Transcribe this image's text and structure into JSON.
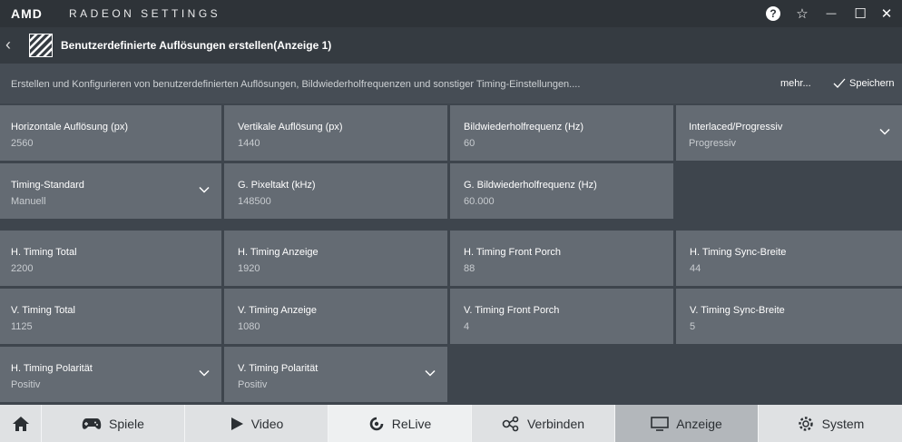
{
  "app": {
    "brand": "AMD",
    "title": "RADEON SETTINGS"
  },
  "window_controls": {
    "help": "?",
    "favorite": "☆",
    "minimize": "—",
    "maximize": "☐",
    "close": "✕"
  },
  "header": {
    "back": "‹",
    "title": "Benutzerdefinierte Auflösungen erstellen(Anzeige 1)"
  },
  "subheader": {
    "description": "Erstellen und Konfigurieren von benutzerdefinierten Auflösungen, Bildwiederholfrequenzen und sonstiger Timing-Einstellungen....",
    "more": "mehr...",
    "save": "Speichern"
  },
  "fields": {
    "h_res": {
      "label": "Horizontale Auflösung (px)",
      "value": "2560"
    },
    "v_res": {
      "label": "Vertikale Auflösung (px)",
      "value": "1440"
    },
    "refresh": {
      "label": "Bildwiederholfrequenz (Hz)",
      "value": "60"
    },
    "interlaced": {
      "label": "Interlaced/Progressiv",
      "value": "Progressiv"
    },
    "timing_std": {
      "label": "Timing-Standard",
      "value": "Manuell"
    },
    "pixel_clock": {
      "label": "G. Pixeltakt (kHz)",
      "value": "148500"
    },
    "g_refresh": {
      "label": "G. Bildwiederholfrequenz (Hz)",
      "value": "60.000"
    },
    "h_total": {
      "label": "H. Timing Total",
      "value": "2200"
    },
    "h_display": {
      "label": "H. Timing Anzeige",
      "value": "1920"
    },
    "h_front": {
      "label": "H. Timing Front Porch",
      "value": "88"
    },
    "h_sync": {
      "label": "H. Timing Sync-Breite",
      "value": "44"
    },
    "v_total": {
      "label": "V. Timing Total",
      "value": "1125"
    },
    "v_display": {
      "label": "V. Timing Anzeige",
      "value": "1080"
    },
    "v_front": {
      "label": "V. Timing Front Porch",
      "value": "4"
    },
    "v_sync": {
      "label": "V. Timing Sync-Breite",
      "value": "5"
    },
    "h_pol": {
      "label": "H. Timing Polarität",
      "value": "Positiv"
    },
    "v_pol": {
      "label": "V. Timing Polarität",
      "value": "Positiv"
    }
  },
  "taskbar": {
    "games": "Spiele",
    "video": "Video",
    "relive": "ReLive",
    "connect": "Verbinden",
    "display": "Anzeige",
    "system": "System"
  },
  "colors": {
    "background": "#3e454d",
    "tile": "#646b73",
    "taskbar": "#dfe1e3",
    "taskbar_active": "#b3b7bb"
  }
}
